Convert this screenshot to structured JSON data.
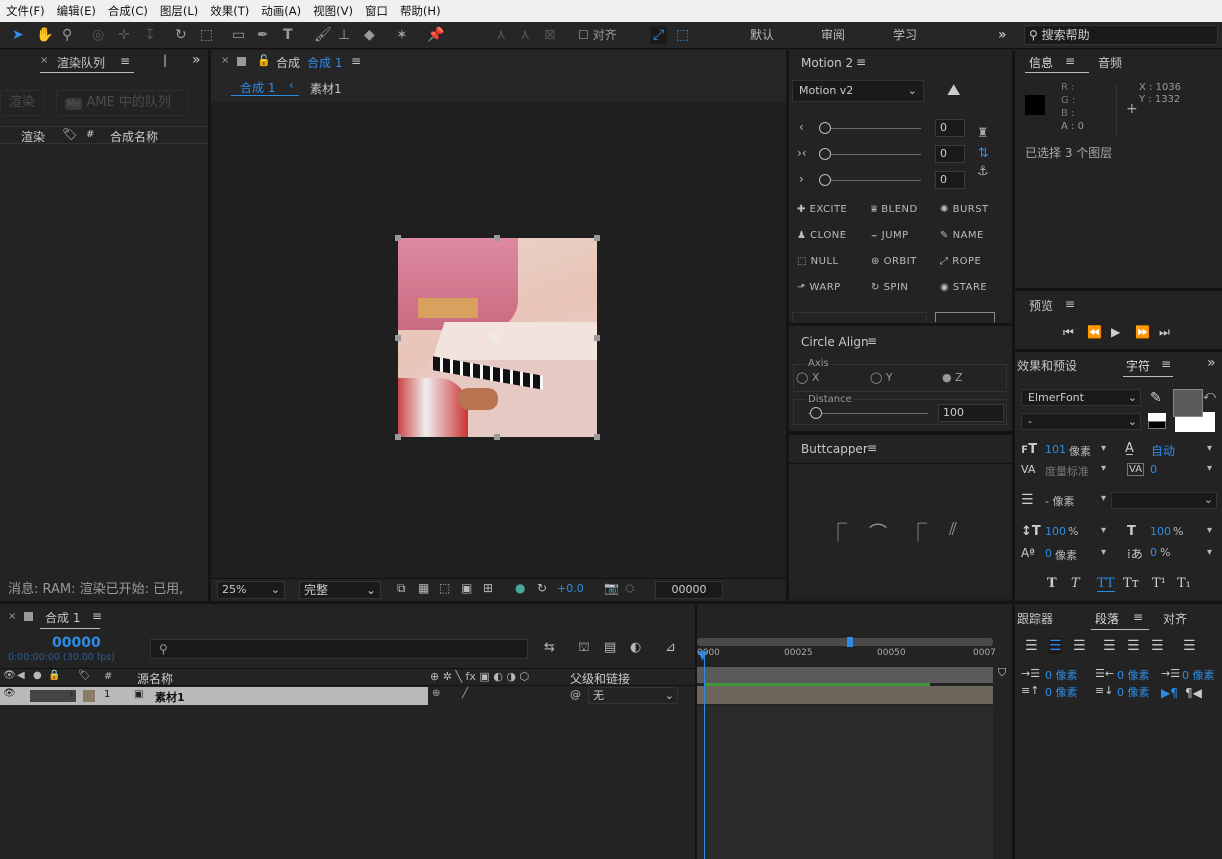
{
  "menu": [
    "文件(F)",
    "编辑(E)",
    "合成(C)",
    "图层(L)",
    "效果(T)",
    "动画(A)",
    "视图(V)",
    "窗口",
    "帮助(H)"
  ],
  "toolbar": {
    "align_label": "对齐",
    "workspaces": [
      "默认",
      "审阅",
      "学习"
    ],
    "search_placeholder": "搜索帮助"
  },
  "render_queue": {
    "tab": "渲染队列",
    "render_btn": "渲染",
    "ame_btn": "AME 中的队列",
    "col_render": "渲染",
    "col_num": "#",
    "col_name": "合成名称",
    "message": "消息: RAM: 渲染已开始: 已用,"
  },
  "comp": {
    "tab_prefix": "合成",
    "tab_name": "合成 1",
    "breadcrumb_comp": "合成 1",
    "breadcrumb_footage": "素材1",
    "zoom": "25%",
    "quality": "完整",
    "exposure": "+0.0",
    "timecode": "00000"
  },
  "motion": {
    "title": "Motion 2",
    "version": "Motion v2",
    "sliders": [
      "0",
      "0",
      "0"
    ],
    "buttons": [
      "EXCITE",
      "BLEND",
      "BURST",
      "CLONE",
      "JUMP",
      "NAME",
      "NULL",
      "ORBIT",
      "ROPE",
      "WARP",
      "SPIN",
      "STARE"
    ]
  },
  "circle_align": {
    "title": "Circle Align",
    "axis_label": "Axis",
    "axes": [
      "X",
      "Y",
      "Z"
    ],
    "distance_label": "Distance",
    "distance": "100"
  },
  "buttcapper": {
    "title": "Buttcapper"
  },
  "info": {
    "tab": "信息",
    "audio_tab": "音频",
    "r": "R :",
    "g": "G :",
    "b": "B :",
    "a": "A : 0",
    "x": "X : 1036",
    "y": "Y : 1332",
    "selected": "已选择 3 个图层"
  },
  "preview": {
    "title": "预览"
  },
  "character": {
    "effects_tab": "效果和预设",
    "char_tab": "字符",
    "font": "ElmerFont",
    "style": "-",
    "size": "101",
    "size_unit": "像素",
    "leading": "自动",
    "kerning": "度量标准",
    "tracking": "0",
    "stroke": "- 像素",
    "vscale": "100",
    "vscale_unit": "%",
    "hscale": "100",
    "hscale_unit": "%",
    "baseline": "0",
    "baseline_unit": "像素",
    "tsume": "0",
    "tsume_unit": "%",
    "styles": [
      "T",
      "T",
      "TT",
      "Tт",
      "T¹",
      "T₁"
    ]
  },
  "paragraph": {
    "tracker_tab": "跟踪器",
    "para_tab": "段落",
    "align_tab": "对齐",
    "values": [
      "0 像素",
      "0 像素",
      "0 像素",
      "0 像素",
      "0 像素"
    ]
  },
  "timeline": {
    "tab": "合成 1",
    "timecode": "00000",
    "timecode_sub": "0:00:00:00 (30.00 fps)",
    "col_num": "#",
    "col_source": "源名称",
    "col_parent": "父级和链接",
    "layer_num": "1",
    "layer_name": "素材1",
    "parent_value": "无",
    "ruler": [
      "0000",
      "00025",
      "00050",
      "0007"
    ]
  }
}
